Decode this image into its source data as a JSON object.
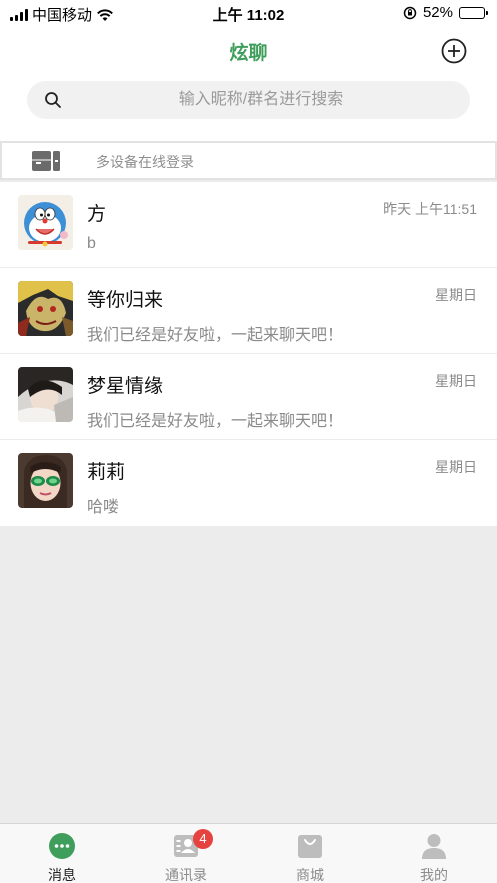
{
  "status_bar": {
    "carrier": "中国移动",
    "time": "上午 11:02",
    "battery": "52%",
    "battery_level": 0.52,
    "icons": [
      "signal-icon",
      "wifi-icon",
      "rotation-lock-icon",
      "battery-icon"
    ]
  },
  "header": {
    "title": "炫聊",
    "add_icon": "plus-circle-icon"
  },
  "search": {
    "placeholder": "输入昵称/群名进行搜索",
    "value": "",
    "icon": "search-icon"
  },
  "device_banner": {
    "text": "多设备在线登录",
    "icon": "devices-icon"
  },
  "chats": [
    {
      "name": "方",
      "time": "昨天 上午11:51",
      "last_message": "b",
      "avatar": "doraemon-avatar"
    },
    {
      "name": "等你归来",
      "time": "星期日",
      "last_message": "我们已经是好友啦，一起来聊天吧！",
      "avatar": "dragon-avatar"
    },
    {
      "name": "梦星情缘",
      "time": "星期日",
      "last_message": "我们已经是好友啦，一起来聊天吧！",
      "avatar": "girl-photo-avatar"
    },
    {
      "name": "莉莉",
      "time": "星期日",
      "last_message": "哈喽",
      "avatar": "sunglasses-photo-avatar"
    }
  ],
  "tab_bar": {
    "tabs": [
      {
        "label": "消息",
        "icon": "chat-bubble-icon",
        "active": true
      },
      {
        "label": "通讯录",
        "icon": "contacts-icon",
        "badge": "4"
      },
      {
        "label": "商城",
        "icon": "shopping-bag-icon"
      },
      {
        "label": "我的",
        "icon": "person-icon"
      }
    ]
  },
  "colors": {
    "accent": "#3f9e5b",
    "badge": "#e64340",
    "page_background": "#ececec"
  }
}
